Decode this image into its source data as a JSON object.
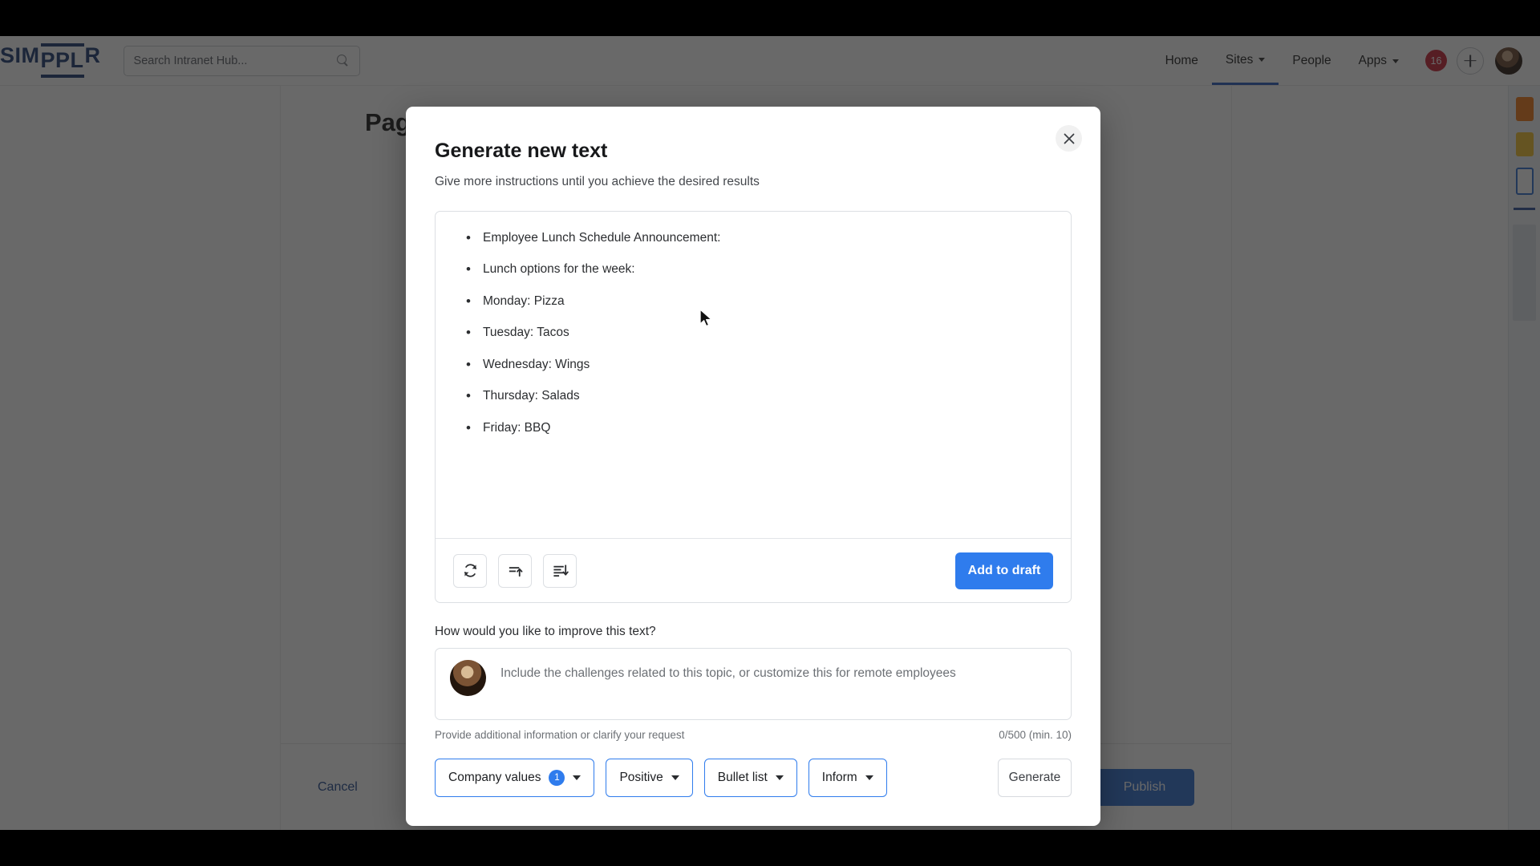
{
  "app": {
    "brand": {
      "pre": "SIM",
      "mid": "PPL",
      "post": "R"
    },
    "search": {
      "placeholder": "Search Intranet Hub...",
      "icon": "search-icon"
    },
    "nav": [
      {
        "label": "Home",
        "has_chevron": false,
        "active": false
      },
      {
        "label": "Sites",
        "has_chevron": true,
        "active": true
      },
      {
        "label": "People",
        "has_chevron": false,
        "active": false
      },
      {
        "label": "Apps",
        "has_chevron": true,
        "active": false
      }
    ],
    "notification_count": "16",
    "create_icon": "plus-icon",
    "avatar": "user-avatar"
  },
  "page": {
    "title": "Page title",
    "cancel_label": "Cancel",
    "publish_label": "Publish"
  },
  "modal": {
    "title": "Generate new text",
    "subtitle": "Give more instructions until you achieve the desired results",
    "close_icon": "close-icon",
    "result": {
      "bullets": [
        "Employee Lunch Schedule Announcement:",
        "Lunch options for the week:",
        "Monday: Pizza",
        "Tuesday: Tacos",
        "Wednesday: Wings",
        "Thursday: Salads",
        "Friday: BBQ"
      ],
      "tools": [
        {
          "name": "regenerate-icon",
          "title": "Regenerate"
        },
        {
          "name": "shorten-icon",
          "title": "Make shorter"
        },
        {
          "name": "expand-icon",
          "title": "Make longer"
        }
      ],
      "add_to_draft_label": "Add to draft"
    },
    "improve": {
      "label": "How would you like to improve this text?",
      "placeholder": "Include the challenges related to this topic, or customize this for remote employees",
      "value": "",
      "helper": "Provide additional information or clarify your request",
      "counter": "0/500 (min. 10)",
      "avatar": "user-avatar-small"
    },
    "chips": [
      {
        "label": "Company values",
        "badge": "1"
      },
      {
        "label": "Positive",
        "badge": ""
      },
      {
        "label": "Bullet list",
        "badge": ""
      },
      {
        "label": "Inform",
        "badge": ""
      }
    ],
    "generate_label": "Generate"
  },
  "colors": {
    "accent_blue": "#2f7ced",
    "brand_navy": "#1f3b73",
    "badge_red": "#c62436",
    "publish_blue": "#2f6fd0"
  }
}
